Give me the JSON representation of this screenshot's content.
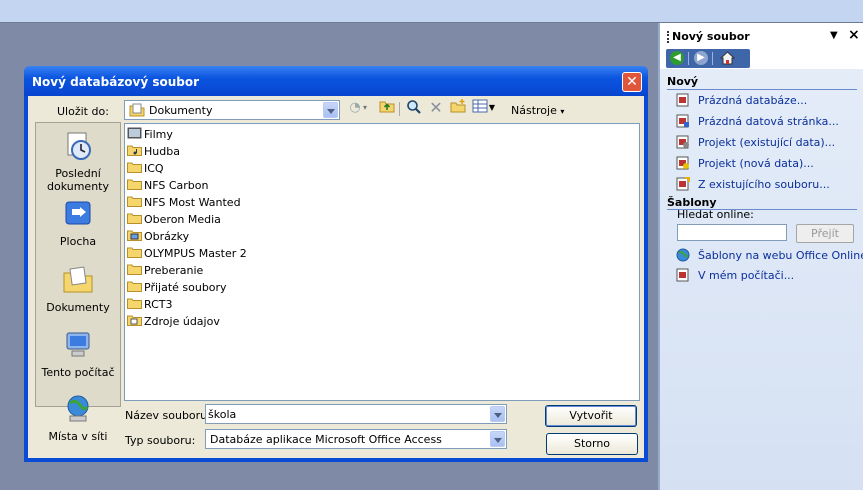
{
  "task_pane": {
    "title": "Nový soubor",
    "sections": {
      "new": "Nový",
      "templates": "Šablony"
    },
    "new_links": [
      {
        "label": "Prázdná databáze...",
        "icon": "blank-database-icon"
      },
      {
        "label": "Prázdná datová stránka...",
        "icon": "blank-page-icon"
      },
      {
        "label": "Projekt (existující data)...",
        "icon": "project-existing-icon"
      },
      {
        "label": "Projekt (nová data)...",
        "icon": "project-new-icon"
      },
      {
        "label": "Z existujícího souboru...",
        "icon": "from-existing-file-icon"
      }
    ],
    "search_label": "Hledat online:",
    "search_value": "",
    "search_button": "Přejít",
    "template_links": [
      {
        "label": "Šablony na webu Office Online",
        "icon": "globe-icon"
      },
      {
        "label": "V mém počítači...",
        "icon": "computer-template-icon"
      }
    ]
  },
  "dialog": {
    "title": "Nový databázový soubor",
    "save_in_label": "Uložit do:",
    "save_in_value": "Dokumenty",
    "tools_label": "Nástroje",
    "places": [
      {
        "label": "Poslední dokumenty",
        "icon": "recent-documents-icon"
      },
      {
        "label": "Plocha",
        "icon": "desktop-icon"
      },
      {
        "label": "Dokumenty",
        "icon": "documents-icon"
      },
      {
        "label": "Tento počítač",
        "icon": "my-computer-icon"
      },
      {
        "label": "Místa v síti",
        "icon": "network-places-icon"
      }
    ],
    "files": [
      {
        "name": "Filmy",
        "icon": "film-folder-icon"
      },
      {
        "name": "Hudba",
        "icon": "music-folder-icon"
      },
      {
        "name": "ICQ",
        "icon": "folder-icon"
      },
      {
        "name": "NFS Carbon",
        "icon": "folder-icon"
      },
      {
        "name": "NFS Most Wanted",
        "icon": "folder-icon"
      },
      {
        "name": "Oberon Media",
        "icon": "folder-icon"
      },
      {
        "name": "Obrázky",
        "icon": "pictures-folder-icon"
      },
      {
        "name": "OLYMPUS Master 2",
        "icon": "folder-icon"
      },
      {
        "name": "Preberanie",
        "icon": "folder-icon"
      },
      {
        "name": "Přijaté soubory",
        "icon": "folder-icon"
      },
      {
        "name": "RCT3",
        "icon": "folder-icon"
      },
      {
        "name": "Zdroje údajov",
        "icon": "datasource-folder-icon"
      }
    ],
    "filename_label": "Název souboru:",
    "filename_value": "škola",
    "filetype_label": "Typ souboru:",
    "filetype_value": "Databáze aplikace Microsoft Office Access",
    "create_button": "Vytvořit",
    "cancel_button": "Storno"
  },
  "colors": {
    "title_blue": "#0b55e0",
    "link_blue": "#0a2f9a",
    "dialog_bg": "#ece9d8",
    "close_red": "#e0563a"
  }
}
